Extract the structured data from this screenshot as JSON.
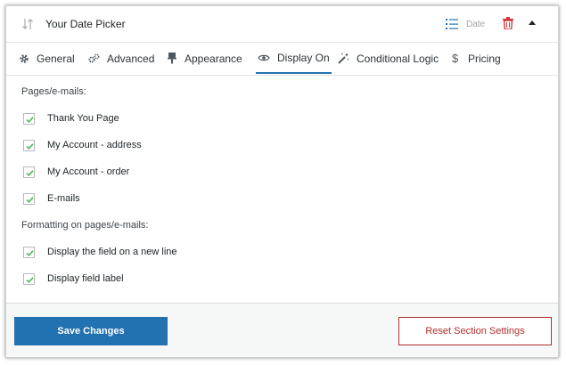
{
  "header": {
    "title": "Your Date Picker",
    "field_type": "Date",
    "icons": [
      "sort-icon",
      "list-icon",
      "trash-icon",
      "collapse-caret-icon"
    ]
  },
  "tabs": [
    {
      "label": "General",
      "icon": "gear-icon",
      "active": false
    },
    {
      "label": "Advanced",
      "icon": "gears-icon",
      "active": false
    },
    {
      "label": "Appearance",
      "icon": "brush-icon",
      "active": false
    },
    {
      "label": "Display On",
      "icon": "eye-icon",
      "active": true
    },
    {
      "label": "Conditional Logic",
      "icon": "magic-wand-icon",
      "active": false
    },
    {
      "label": "Pricing",
      "icon": "dollar-icon",
      "active": false
    }
  ],
  "sections": {
    "pages_label": "Pages/e-mails:",
    "pages": [
      {
        "label": "Thank You Page",
        "checked": true
      },
      {
        "label": "My Account - address",
        "checked": true
      },
      {
        "label": "My Account - order",
        "checked": true
      },
      {
        "label": "E-mails",
        "checked": true
      }
    ],
    "formatting_label": "Formatting on pages/e-mails:",
    "formatting": [
      {
        "label": "Display the field on a new line",
        "checked": true
      },
      {
        "label": "Display field label",
        "checked": true
      }
    ]
  },
  "buttons": {
    "save_label": "Save Changes",
    "reset_label": "Reset Section Settings"
  },
  "colors": {
    "accent": "#2271b1",
    "danger": "#b32d2e",
    "check": "#46b450"
  }
}
